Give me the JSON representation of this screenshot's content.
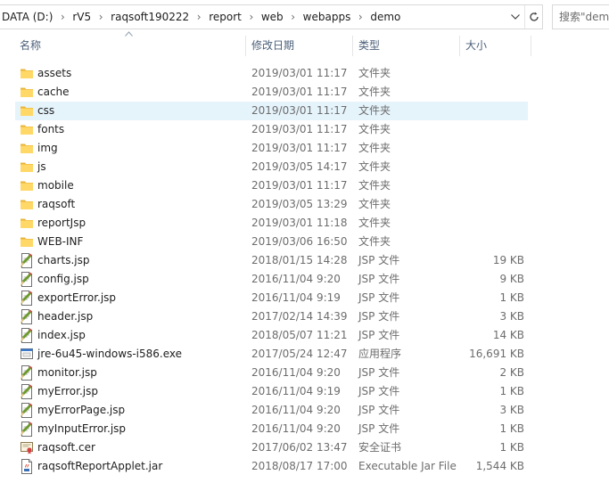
{
  "address": {
    "crumbs": [
      "DATA (D:)",
      "rV5",
      "raqsoft190222",
      "report",
      "web",
      "webapps",
      "demo"
    ]
  },
  "search": {
    "placeholder": "搜索\"demo\""
  },
  "columns": {
    "name": "名称",
    "date": "修改日期",
    "type": "类型",
    "size": "大小"
  },
  "files": [
    {
      "name": "assets",
      "date": "2019/03/01 11:17",
      "type": "文件夹",
      "size": "",
      "icon": "folder-icon"
    },
    {
      "name": "cache",
      "date": "2019/03/01 11:17",
      "type": "文件夹",
      "size": "",
      "icon": "folder-icon"
    },
    {
      "name": "css",
      "date": "2019/03/01 11:17",
      "type": "文件夹",
      "size": "",
      "icon": "folder-icon",
      "selected": true
    },
    {
      "name": "fonts",
      "date": "2019/03/01 11:17",
      "type": "文件夹",
      "size": "",
      "icon": "folder-icon"
    },
    {
      "name": "img",
      "date": "2019/03/01 11:17",
      "type": "文件夹",
      "size": "",
      "icon": "folder-icon"
    },
    {
      "name": "js",
      "date": "2019/03/05 14:17",
      "type": "文件夹",
      "size": "",
      "icon": "folder-icon"
    },
    {
      "name": "mobile",
      "date": "2019/03/01 11:17",
      "type": "文件夹",
      "size": "",
      "icon": "folder-icon"
    },
    {
      "name": "raqsoft",
      "date": "2019/03/05 13:29",
      "type": "文件夹",
      "size": "",
      "icon": "folder-icon"
    },
    {
      "name": "reportJsp",
      "date": "2019/03/01 11:18",
      "type": "文件夹",
      "size": "",
      "icon": "folder-icon"
    },
    {
      "name": "WEB-INF",
      "date": "2019/03/06 16:50",
      "type": "文件夹",
      "size": "",
      "icon": "folder-icon"
    },
    {
      "name": "charts.jsp",
      "date": "2018/01/15 14:28",
      "type": "JSP 文件",
      "size": "19 KB",
      "icon": "jsp-file-icon"
    },
    {
      "name": "config.jsp",
      "date": "2016/11/04 9:20",
      "type": "JSP 文件",
      "size": "9 KB",
      "icon": "jsp-file-icon"
    },
    {
      "name": "exportError.jsp",
      "date": "2016/11/04 9:19",
      "type": "JSP 文件",
      "size": "1 KB",
      "icon": "jsp-file-icon"
    },
    {
      "name": "header.jsp",
      "date": "2017/02/14 14:39",
      "type": "JSP 文件",
      "size": "3 KB",
      "icon": "jsp-file-icon"
    },
    {
      "name": "index.jsp",
      "date": "2018/05/07 11:21",
      "type": "JSP 文件",
      "size": "14 KB",
      "icon": "jsp-file-icon"
    },
    {
      "name": "jre-6u45-windows-i586.exe",
      "date": "2017/05/24 12:47",
      "type": "应用程序",
      "size": "16,691 KB",
      "icon": "exe-file-icon"
    },
    {
      "name": "monitor.jsp",
      "date": "2016/11/04 9:20",
      "type": "JSP 文件",
      "size": "2 KB",
      "icon": "jsp-file-icon"
    },
    {
      "name": "myError.jsp",
      "date": "2016/11/04 9:19",
      "type": "JSP 文件",
      "size": "1 KB",
      "icon": "jsp-file-icon"
    },
    {
      "name": "myErrorPage.jsp",
      "date": "2016/11/04 9:20",
      "type": "JSP 文件",
      "size": "3 KB",
      "icon": "jsp-file-icon"
    },
    {
      "name": "myInputError.jsp",
      "date": "2016/11/04 9:20",
      "type": "JSP 文件",
      "size": "1 KB",
      "icon": "jsp-file-icon"
    },
    {
      "name": "raqsoft.cer",
      "date": "2017/06/02 13:47",
      "type": "安全证书",
      "size": "1 KB",
      "icon": "certificate-file-icon"
    },
    {
      "name": "raqsoftReportApplet.jar",
      "date": "2018/08/17 17:00",
      "type": "Executable Jar File",
      "size": "1,544 KB",
      "icon": "jar-file-icon"
    }
  ],
  "colors": {
    "selected_row": "#e5f3fb",
    "folder": "#ffd867",
    "header_text": "#4c607a",
    "secondary_text": "#6d6d6d"
  }
}
